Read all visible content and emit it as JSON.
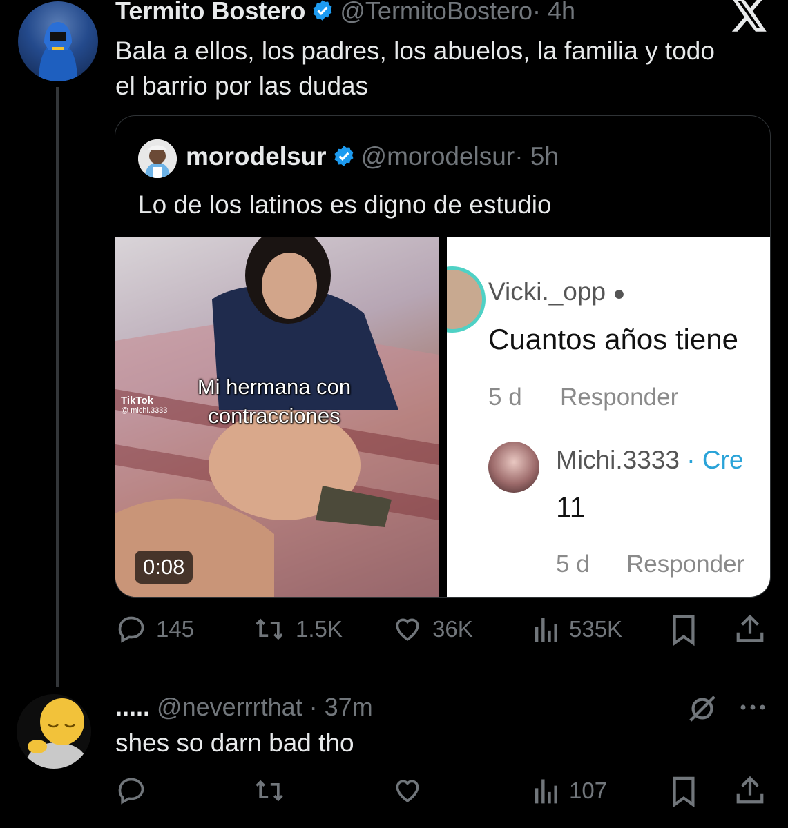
{
  "main_post": {
    "display_name": "Termito Bostero",
    "handle": "@TermitoBostero",
    "time": "· 4h",
    "text": "Bala a ellos, los padres, los abuelos, la familia y todo el barrio por las dudas"
  },
  "quoted_post": {
    "display_name": "morodelsur",
    "handle": "@morodelsur",
    "time": "· 5h",
    "text": "Lo de los latinos es digno de estudio",
    "video": {
      "caption": "Mi hermana con contracciones",
      "watermark": "TikTok",
      "watermark_user": "@ michi.3333",
      "duration": "0:08"
    },
    "screenshot": {
      "user1": "Vicki._opp ",
      "comment1": "Cuantos años tiene",
      "age1": "5 d",
      "reply_label1": "Responder",
      "user2": "Michi.3333",
      "user2_suffix": "· Cre",
      "reply2": "11",
      "age2": "5 d",
      "reply_label2": "Responder"
    }
  },
  "main_actions": {
    "replies": "145",
    "reposts": "1.5K",
    "likes": "36K",
    "views": "535K"
  },
  "reply_post": {
    "display_name": ".....",
    "handle": "@neverrrthat",
    "time": "· 37m",
    "text": "shes so darn bad tho"
  },
  "reply_actions": {
    "views": "107"
  },
  "colors": {
    "background": "#000000",
    "text": "#e7e9ea",
    "secondary": "#71767b",
    "verified": "#1d9bf0"
  },
  "icons": [
    "x-logo-icon",
    "verified-badge-icon",
    "reply-icon",
    "repost-icon",
    "like-icon",
    "views-icon",
    "bookmark-icon",
    "share-icon",
    "grok-icon",
    "more-icon",
    "apple-icon"
  ]
}
